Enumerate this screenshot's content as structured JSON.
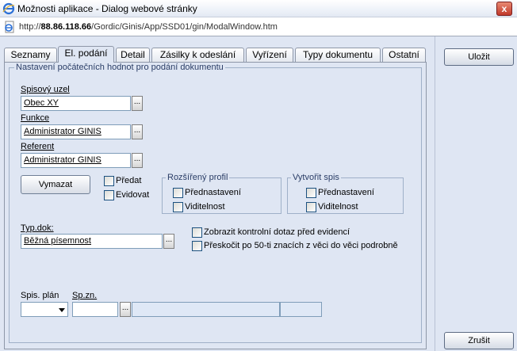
{
  "window": {
    "title": "Možnosti aplikace - Dialog webové stránky",
    "close_label": "x"
  },
  "address": {
    "url_prefix": "http://",
    "url_host": "88.86.118.66",
    "url_path": "/Gordic/Ginis/App/SSD01/gin/ModalWindow.htm"
  },
  "tabs": [
    {
      "label": "Seznamy"
    },
    {
      "label": "El. podání",
      "active": true
    },
    {
      "label": "Detail"
    },
    {
      "label": "Zásilky k odeslání"
    },
    {
      "label": "Vyřízení"
    },
    {
      "label": "Typy dokumentu"
    },
    {
      "label": "Ostatní"
    }
  ],
  "form": {
    "legend": "Nastavení počátečních hodnot pro podání dokumentu",
    "spisovy_uzel": {
      "label": "Spisový uzel",
      "value": "Obec XY"
    },
    "funkce": {
      "label": "Funkce",
      "value": "Administrator GINIS"
    },
    "referent": {
      "label": "Referent",
      "value": "Administrator GINIS"
    },
    "dots_label": "...",
    "vymazat_label": "Vymazat",
    "predat_label": "Předat",
    "evidovat_label": "Evidovat",
    "rozsireny_profil": {
      "legend": "Rozšířený profil",
      "prednastaveni": "Přednastavení",
      "viditelnost": "Viditelnost"
    },
    "vytvorit_spis": {
      "legend": "Vytvořit spis",
      "prednastaveni": "Přednastavení",
      "viditelnost": "Viditelnost"
    },
    "typ_dok": {
      "label": "Typ.dok:",
      "value": "Běžná písemnost"
    },
    "zobrazit_dotaz": "Zobrazit kontrolní dotaz před evidencí",
    "preskocit": "Přeskočit po 50-ti znacích z věci do věci podrobně",
    "spis_plan_label": "Spis. plán",
    "sp_zn_label": "Sp.zn."
  },
  "actions": {
    "ulozit": "Uložit",
    "zrusit": "Zrušit"
  },
  "icons": {
    "app": "ie-icon",
    "page": "ie-page-icon"
  }
}
